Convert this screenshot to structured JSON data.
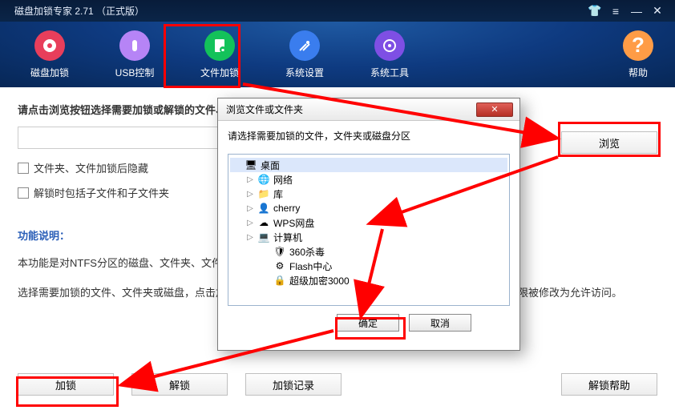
{
  "title": "磁盘加锁专家 2.71 （正式版）",
  "nav": [
    {
      "label": "磁盘加锁",
      "color": "#e83e5b"
    },
    {
      "label": "USB控制",
      "color": "#b684f6"
    },
    {
      "label": "文件加锁",
      "color": "#13c25a"
    },
    {
      "label": "系统设置",
      "color": "#3a7dee"
    },
    {
      "label": "系统工具",
      "color": "#7e4fe4"
    }
  ],
  "help_label": "帮助",
  "heading": "请点击浏览按钮选择需要加锁或解锁的文件、文件夹或磁盘：",
  "checkbox1": "文件夹、文件加锁后隐藏",
  "checkbox2": "解锁时包括子文件和子文件夹",
  "subheading": "功能说明：",
  "para1": "本功能是对NTFS分区的磁盘、文件夹、文件的访问权限修改为拒绝访问，解锁是把访问权限修改为允许访问。",
  "para2": "选择需要加锁的文件、文件夹或磁盘，点击加锁按钮。如果需要解锁，请点击浏览选择需要解锁的对象访问权限被修改为允许访问。",
  "browse_label": "浏览",
  "btn_lock": "加锁",
  "btn_unlock": "解锁",
  "btn_log": "加锁记录",
  "btn_help": "解锁帮助",
  "dialog": {
    "title": "浏览文件或文件夹",
    "prompt": "请选择需要加锁的文件，文件夹或磁盘分区",
    "ok": "确定",
    "cancel": "取消",
    "tree": [
      {
        "label": "桌面",
        "level": 0,
        "icon": "🖥",
        "exp": ""
      },
      {
        "label": "网络",
        "level": 1,
        "icon": "🌐",
        "exp": "▷"
      },
      {
        "label": "库",
        "level": 1,
        "icon": "📁",
        "exp": "▷"
      },
      {
        "label": "cherry",
        "level": 1,
        "icon": "👤",
        "exp": "▷"
      },
      {
        "label": "WPS网盘",
        "level": 1,
        "icon": "☁",
        "exp": "▷"
      },
      {
        "label": "计算机",
        "level": 1,
        "icon": "💻",
        "exp": "▷"
      },
      {
        "label": "360杀毒",
        "level": 2,
        "icon": "🛡",
        "exp": ""
      },
      {
        "label": "Flash中心",
        "level": 2,
        "icon": "⚙",
        "exp": ""
      },
      {
        "label": "超级加密3000",
        "level": 2,
        "icon": "🔒",
        "exp": ""
      }
    ]
  }
}
